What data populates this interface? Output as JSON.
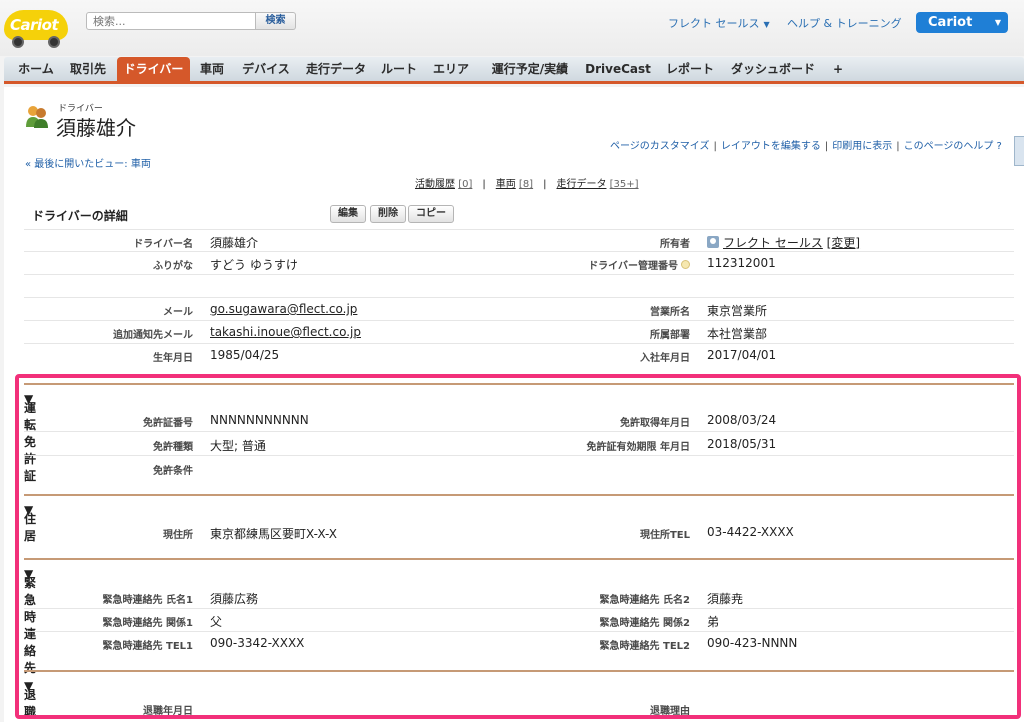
{
  "header": {
    "logo_text": "Cariot",
    "search_placeholder": "検索...",
    "search_button": "検索",
    "user_menu": "フレクト セールス",
    "help_link": "ヘルプ & トレーニング",
    "app_menu": "Cariot"
  },
  "tabs": [
    {
      "label": "ホーム"
    },
    {
      "label": "取引先"
    },
    {
      "label": "ドライバー",
      "active": true
    },
    {
      "label": "車両"
    },
    {
      "label": "デバイス"
    },
    {
      "label": "走行データ"
    },
    {
      "label": "ルート"
    },
    {
      "label": "エリア"
    },
    {
      "label": "運行予定/実績"
    },
    {
      "label": "DriveCast"
    },
    {
      "label": "レポート"
    },
    {
      "label": "ダッシュボード"
    },
    {
      "label": "+"
    }
  ],
  "page": {
    "object_type": "ドライバー",
    "title": "須藤雄介",
    "help_links": [
      "ページのカスタマイズ",
      "レイアウトを編集する",
      "印刷用に表示",
      "このページのヘルプ"
    ],
    "recent_view": "« 最後に開いたビュー: 車両",
    "related": [
      {
        "label": "活動履歴",
        "count": "[0]"
      },
      {
        "label": "車両",
        "count": "[8]"
      },
      {
        "label": "走行データ",
        "count": "[35+]"
      }
    ]
  },
  "detail": {
    "heading": "ドライバーの詳細",
    "buttons": {
      "edit": "編集",
      "delete": "削除",
      "copy": "コピー"
    },
    "fields": {
      "driver_name": {
        "label": "ドライバー名",
        "value": "須藤雄介"
      },
      "owner": {
        "label": "所有者",
        "value": "フレクト セールス",
        "change": "[変更]"
      },
      "furigana": {
        "label": "ふりがな",
        "value": "すどう ゆうすけ"
      },
      "mgmt_no": {
        "label": "ドライバー管理番号",
        "value": "112312001"
      },
      "email": {
        "label": "メール",
        "value": "go.sugawara@flect.co.jp"
      },
      "office": {
        "label": "営業所名",
        "value": "東京営業所"
      },
      "extra_email": {
        "label": "追加通知先メール",
        "value": "takashi.inoue@flect.co.jp"
      },
      "dept": {
        "label": "所属部署",
        "value": "本社営業部"
      },
      "birth": {
        "label": "生年月日",
        "value": "1985/04/25"
      },
      "hire": {
        "label": "入社年月日",
        "value": "2017/04/01"
      }
    }
  },
  "sections": {
    "license": {
      "title": "運転免許証",
      "number": {
        "label": "免許証番号",
        "value": "NNNNNNNNNNN"
      },
      "acquired": {
        "label": "免許取得年月日",
        "value": "2008/03/24"
      },
      "type": {
        "label": "免許種類",
        "value": "大型; 普通"
      },
      "expiry": {
        "label": "免許証有効期限 年月日",
        "value": "2018/05/31"
      },
      "conditions": {
        "label": "免許条件",
        "value": ""
      }
    },
    "residence": {
      "title": "住居",
      "address": {
        "label": "現住所",
        "value": "東京都練馬区要町X-X-X"
      },
      "tel": {
        "label": "現住所TEL",
        "value": "03-4422-XXXX"
      }
    },
    "emergency": {
      "title": "緊急時連絡先",
      "name1": {
        "label": "緊急時連絡先 氏名1",
        "value": "須藤広務"
      },
      "name2": {
        "label": "緊急時連絡先 氏名2",
        "value": "須藤尭"
      },
      "rel1": {
        "label": "緊急時連絡先 関係1",
        "value": "父"
      },
      "rel2": {
        "label": "緊急時連絡先 関係2",
        "value": "弟"
      },
      "tel1": {
        "label": "緊急時連絡先 TEL1",
        "value": "090-3342-XXXX"
      },
      "tel2": {
        "label": "緊急時連絡先 TEL2",
        "value": "090-423-NNNN"
      }
    },
    "retirement": {
      "title": "退職",
      "date": {
        "label": "退職年月日",
        "value": ""
      },
      "reason": {
        "label": "退職理由",
        "value": ""
      }
    }
  },
  "colors": {
    "accent": "#d5582a",
    "highlight": "#f2307a",
    "link": "#1f5fa7"
  }
}
